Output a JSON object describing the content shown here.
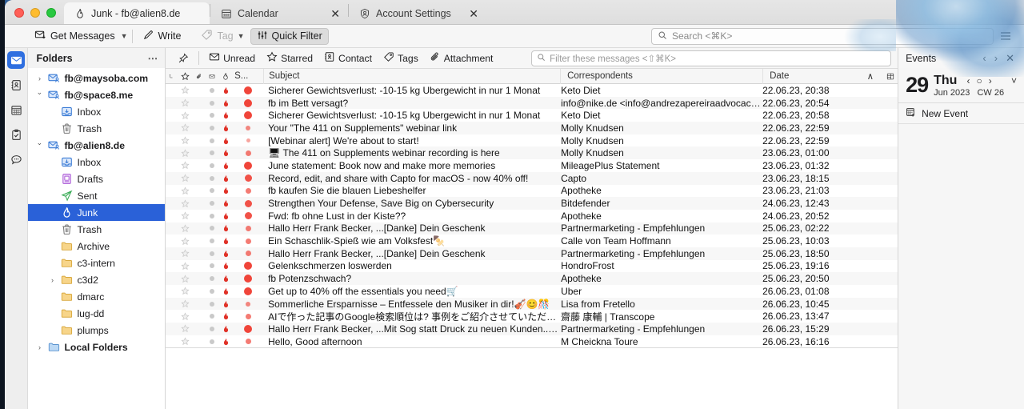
{
  "window": {
    "traffic_lights": [
      "close",
      "minimize",
      "zoom"
    ]
  },
  "tabs": [
    {
      "icon": "flame-icon",
      "label": "Junk - fb@alien8.de",
      "active": true,
      "closable": false
    },
    {
      "icon": "calendar-icon",
      "label": "Calendar",
      "active": false,
      "closable": true
    },
    {
      "icon": "account-icon",
      "label": "Account Settings",
      "active": false,
      "closable": true
    }
  ],
  "toolbar": {
    "get_messages": "Get Messages",
    "write": "Write",
    "tag": "Tag",
    "quick_filter": "Quick Filter",
    "search_placeholder": "Search <⌘K>",
    "search_value": "",
    "menu_icon": "hamburger-icon"
  },
  "rail": {
    "items": [
      {
        "icon": "mail-icon",
        "label": "Mail",
        "selected": true
      },
      {
        "icon": "address-book-icon",
        "label": "Address Book",
        "selected": false
      },
      {
        "icon": "calendar-icon",
        "label": "Calendar",
        "selected": false
      },
      {
        "icon": "tasks-icon",
        "label": "Tasks",
        "selected": false
      },
      {
        "icon": "chat-icon",
        "label": "Chat",
        "selected": false
      }
    ]
  },
  "folders": {
    "title": "Folders",
    "more_icon": "ellipsis-icon",
    "items": [
      {
        "label": "fb@maysoba.com",
        "icon": "account-mail-icon",
        "indent": 0,
        "twisty": "collapsed",
        "bold": true,
        "selected": false
      },
      {
        "label": "fb@space8.me",
        "icon": "account-mail-icon",
        "indent": 0,
        "twisty": "expanded",
        "bold": true,
        "selected": false
      },
      {
        "label": "Inbox",
        "icon": "inbox-icon",
        "indent": 1,
        "twisty": "none",
        "bold": false,
        "selected": false
      },
      {
        "label": "Trash",
        "icon": "trash-icon",
        "indent": 1,
        "twisty": "none",
        "bold": false,
        "selected": false
      },
      {
        "label": "fb@alien8.de",
        "icon": "account-mail-icon",
        "indent": 0,
        "twisty": "expanded",
        "bold": true,
        "selected": false
      },
      {
        "label": "Inbox",
        "icon": "inbox-icon",
        "indent": 1,
        "twisty": "none",
        "bold": false,
        "selected": false
      },
      {
        "label": "Drafts",
        "icon": "drafts-icon",
        "indent": 1,
        "twisty": "none",
        "bold": false,
        "selected": false
      },
      {
        "label": "Sent",
        "icon": "sent-icon",
        "indent": 1,
        "twisty": "none",
        "bold": false,
        "selected": false
      },
      {
        "label": "Junk",
        "icon": "flame-icon",
        "indent": 1,
        "twisty": "none",
        "bold": false,
        "selected": true
      },
      {
        "label": "Trash",
        "icon": "trash-icon",
        "indent": 1,
        "twisty": "none",
        "bold": false,
        "selected": false
      },
      {
        "label": "Archive",
        "icon": "folder-icon",
        "indent": 1,
        "twisty": "none",
        "bold": false,
        "selected": false
      },
      {
        "label": "c3-intern",
        "icon": "folder-icon",
        "indent": 1,
        "twisty": "none",
        "bold": false,
        "selected": false
      },
      {
        "label": "c3d2",
        "icon": "folder-icon",
        "indent": 1,
        "twisty": "collapsed",
        "bold": false,
        "selected": false
      },
      {
        "label": "dmarc",
        "icon": "folder-icon",
        "indent": 1,
        "twisty": "none",
        "bold": false,
        "selected": false
      },
      {
        "label": "lug-dd",
        "icon": "folder-icon",
        "indent": 1,
        "twisty": "none",
        "bold": false,
        "selected": false
      },
      {
        "label": "plumps",
        "icon": "folder-icon",
        "indent": 1,
        "twisty": "none",
        "bold": false,
        "selected": false
      },
      {
        "label": "Local Folders",
        "icon": "local-folder-icon",
        "indent": 0,
        "twisty": "collapsed",
        "bold": true,
        "selected": false
      }
    ]
  },
  "quick_filter": {
    "pin_icon": "pin-icon",
    "buttons": [
      {
        "icon": "envelope-icon",
        "label": "Unread"
      },
      {
        "icon": "star-icon",
        "label": "Starred"
      },
      {
        "icon": "contact-icon",
        "label": "Contact"
      },
      {
        "icon": "tag-icon",
        "label": "Tags"
      },
      {
        "icon": "paperclip-icon",
        "label": "Attachment"
      }
    ],
    "filter_placeholder": "Filter these messages <⇧⌘K>",
    "filter_value": ""
  },
  "message_list": {
    "columns": {
      "thread_icon": "thread-icon",
      "star_icon": "star-icon",
      "attachment_icon": "paperclip-icon",
      "unread_icon": "read-status-icon",
      "junk_icon": "flame-icon",
      "spam": "S...",
      "subject": "Subject",
      "correspondents": "Correspondents",
      "date": "Date",
      "sort_indicator": "∧",
      "column_picker_icon": "column-picker-icon"
    },
    "rows": [
      {
        "subject": "Sicherer Gewichtsverlust: -10-15 kg Ubergewicht in nur 1 Monat",
        "correspondent": "Keto Diet",
        "date": "22.06.23, 20:38",
        "spam": 9,
        "emoji": ""
      },
      {
        "subject": "fb im Bett versagt?",
        "correspondent": "info@nike.de <info@andrezapereiraadvocacia.co…",
        "date": "22.06.23, 20:54",
        "spam": 9,
        "emoji": ""
      },
      {
        "subject": "Sicherer Gewichtsverlust: -10-15 kg Ubergewicht in nur 1 Monat",
        "correspondent": "Keto Diet",
        "date": "22.06.23, 20:58",
        "spam": 9,
        "emoji": ""
      },
      {
        "subject": "Your \"The 411 on Supplements\" webinar link",
        "correspondent": "Molly Knudsen",
        "date": "22.06.23, 22:59",
        "spam": 4,
        "emoji": ""
      },
      {
        "subject": "[Webinar alert] We're about to start!",
        "correspondent": "Molly Knudsen",
        "date": "22.06.23, 22:59",
        "spam": 2,
        "emoji": ""
      },
      {
        "subject": "The 411 on Supplements webinar recording is here",
        "correspondent": "Molly Knudsen",
        "date": "23.06.23, 01:00",
        "spam": 5,
        "emoji": "🖥"
      },
      {
        "subject": "June statement: Book now and make more memories",
        "correspondent": "MileagePlus Statement",
        "date": "23.06.23, 01:32",
        "spam": 9,
        "emoji": ""
      },
      {
        "subject": "Record, edit, and share with Capto for macOS - now 40% off!",
        "correspondent": "Capto",
        "date": "23.06.23, 18:15",
        "spam": 8,
        "emoji": ""
      },
      {
        "subject": "fb kaufen Sie die blauen Liebeshelfer",
        "correspondent": "Apotheke",
        "date": "23.06.23, 21:03",
        "spam": 5,
        "emoji": ""
      },
      {
        "subject": "Strengthen Your Defense, Save Big on Cybersecurity",
        "correspondent": "Bitdefender",
        "date": "24.06.23, 12:43",
        "spam": 8,
        "emoji": ""
      },
      {
        "subject": "Fwd: fb ohne Lust in der Kiste??",
        "correspondent": "Apotheke",
        "date": "24.06.23, 20:52",
        "spam": 8,
        "emoji": ""
      },
      {
        "subject": "Hallo Herr Frank Becker, ...[Danke] Dein Geschenk",
        "correspondent": "Partnermarketing - Empfehlungen",
        "date": "25.06.23, 02:22",
        "spam": 5,
        "emoji": ""
      },
      {
        "subject": "Ein Schaschlik-Spieß wie am Volksfest",
        "correspondent": "Calle von Team Hoffmann",
        "date": "25.06.23, 10:03",
        "spam": 5,
        "emoji": "🍢"
      },
      {
        "subject": "Hallo Herr Frank Becker, ...[Danke] Dein Geschenk",
        "correspondent": "Partnermarketing - Empfehlungen",
        "date": "25.06.23, 18:50",
        "spam": 5,
        "emoji": ""
      },
      {
        "subject": "Gelenkschmerzen loswerden",
        "correspondent": "HondroFrost",
        "date": "25.06.23, 19:16",
        "spam": 9,
        "emoji": ""
      },
      {
        "subject": "fb Potenzschwach?",
        "correspondent": "Apotheke",
        "date": "25.06.23, 20:50",
        "spam": 9,
        "emoji": ""
      },
      {
        "subject": "Get up to 40% off the essentials you need",
        "correspondent": "Uber",
        "date": "26.06.23, 01:08",
        "spam": 9,
        "emoji": "🛒"
      },
      {
        "subject": "Sommerliche Ersparnisse – Entfessele den Musiker in dir!",
        "correspondent": "Lisa from Fretello",
        "date": "26.06.23, 10:45",
        "spam": 4,
        "emoji": "🎻😊🎊"
      },
      {
        "subject": "AIで作った記事のGoogle検索順位は? 事例をご紹介させていただきます。",
        "correspondent": "齋藤 康輔 | Transcope",
        "date": "26.06.23, 13:47",
        "spam": 5,
        "emoji": ""
      },
      {
        "subject": "Hallo Herr Frank Becker, ...Mit Sog statt Druck zu neuen Kunden....heute bis F…",
        "correspondent": "Partnermarketing - Empfehlungen",
        "date": "26.06.23, 15:29",
        "spam": 9,
        "emoji": ""
      },
      {
        "subject": "Hello, Good afternoon",
        "correspondent": "M Cheickna Toure",
        "date": "26.06.23, 16:16",
        "spam": 5,
        "emoji": ""
      }
    ]
  },
  "events": {
    "title": "Events",
    "prev_icon": "chevron-left-icon",
    "next_icon": "chevron-right-icon",
    "close_icon": "close-icon",
    "day_number": "29",
    "day_name": "Thu",
    "month_year": "Jun 2023",
    "week": "CW 26",
    "nav_prev": "‹",
    "nav_today": "○",
    "nav_next": "›",
    "expand_icon": "chevron-down-icon",
    "new_event": "New Event",
    "new_event_icon": "new-event-icon"
  },
  "colors": {
    "accent": "#2a61d8",
    "spam_dot": "#f0453a",
    "junk_flame": "#d93025",
    "rail_selected": "#2f6fe0"
  }
}
